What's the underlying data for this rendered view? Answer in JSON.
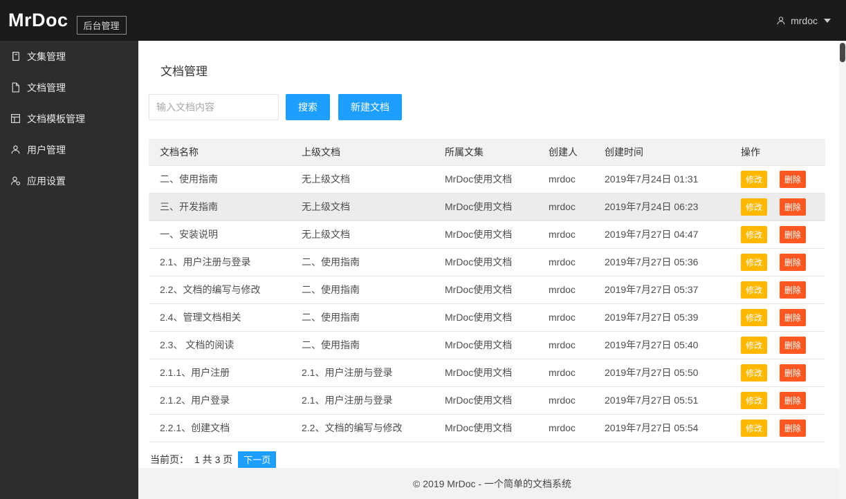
{
  "header": {
    "logo": "MrDoc",
    "badge": "后台管理",
    "user": "mrdoc"
  },
  "sidebar": {
    "items": [
      {
        "label": "文集管理",
        "icon": "book-icon"
      },
      {
        "label": "文档管理",
        "icon": "document-icon"
      },
      {
        "label": "文档模板管理",
        "icon": "template-icon"
      },
      {
        "label": "用户管理",
        "icon": "users-icon"
      },
      {
        "label": "应用设置",
        "icon": "settings-icon"
      }
    ]
  },
  "main": {
    "title": "文档管理",
    "search": {
      "placeholder": "输入文档内容",
      "search_button": "搜索",
      "new_button": "新建文档"
    },
    "table": {
      "headers": [
        "文档名称",
        "上级文档",
        "所属文集",
        "创建人",
        "创建时间",
        "操作"
      ],
      "action_modify": "修改",
      "action_delete": "删除",
      "rows": [
        {
          "name": "二、使用指南",
          "parent": "无上级文档",
          "collection": "MrDoc使用文档",
          "creator": "mrdoc",
          "created": "2019年7月24日 01:31",
          "highlight": false
        },
        {
          "name": "三、开发指南",
          "parent": "无上级文档",
          "collection": "MrDoc使用文档",
          "creator": "mrdoc",
          "created": "2019年7月24日 06:23",
          "highlight": true
        },
        {
          "name": "一、安装说明",
          "parent": "无上级文档",
          "collection": "MrDoc使用文档",
          "creator": "mrdoc",
          "created": "2019年7月27日 04:47",
          "highlight": false
        },
        {
          "name": "2.1、用户注册与登录",
          "parent": "二、使用指南",
          "collection": "MrDoc使用文档",
          "creator": "mrdoc",
          "created": "2019年7月27日 05:36",
          "highlight": false
        },
        {
          "name": "2.2、文档的编写与修改",
          "parent": "二、使用指南",
          "collection": "MrDoc使用文档",
          "creator": "mrdoc",
          "created": "2019年7月27日 05:37",
          "highlight": false
        },
        {
          "name": "2.4、管理文档相关",
          "parent": "二、使用指南",
          "collection": "MrDoc使用文档",
          "creator": "mrdoc",
          "created": "2019年7月27日 05:39",
          "highlight": false
        },
        {
          "name": "2.3、 文档的阅读",
          "parent": "二、使用指南",
          "collection": "MrDoc使用文档",
          "creator": "mrdoc",
          "created": "2019年7月27日 05:40",
          "highlight": false
        },
        {
          "name": "2.1.1、用户注册",
          "parent": "2.1、用户注册与登录",
          "collection": "MrDoc使用文档",
          "creator": "mrdoc",
          "created": "2019年7月27日 05:50",
          "highlight": false
        },
        {
          "name": "2.1.2、用户登录",
          "parent": "2.1、用户注册与登录",
          "collection": "MrDoc使用文档",
          "creator": "mrdoc",
          "created": "2019年7月27日 05:51",
          "highlight": false
        },
        {
          "name": "2.2.1、创建文档",
          "parent": "2.2、文档的编写与修改",
          "collection": "MrDoc使用文档",
          "creator": "mrdoc",
          "created": "2019年7月27日 05:54",
          "highlight": false
        }
      ]
    },
    "pagination": {
      "label": "当前页：",
      "info": "1 共 3 页",
      "next_button": "下一页"
    }
  },
  "footer": {
    "text": "© 2019 MrDoc - 一个简单的文档系统"
  },
  "colors": {
    "accent": "#1E9FFF",
    "modify": "#FFB800",
    "delete": "#FF5722"
  }
}
